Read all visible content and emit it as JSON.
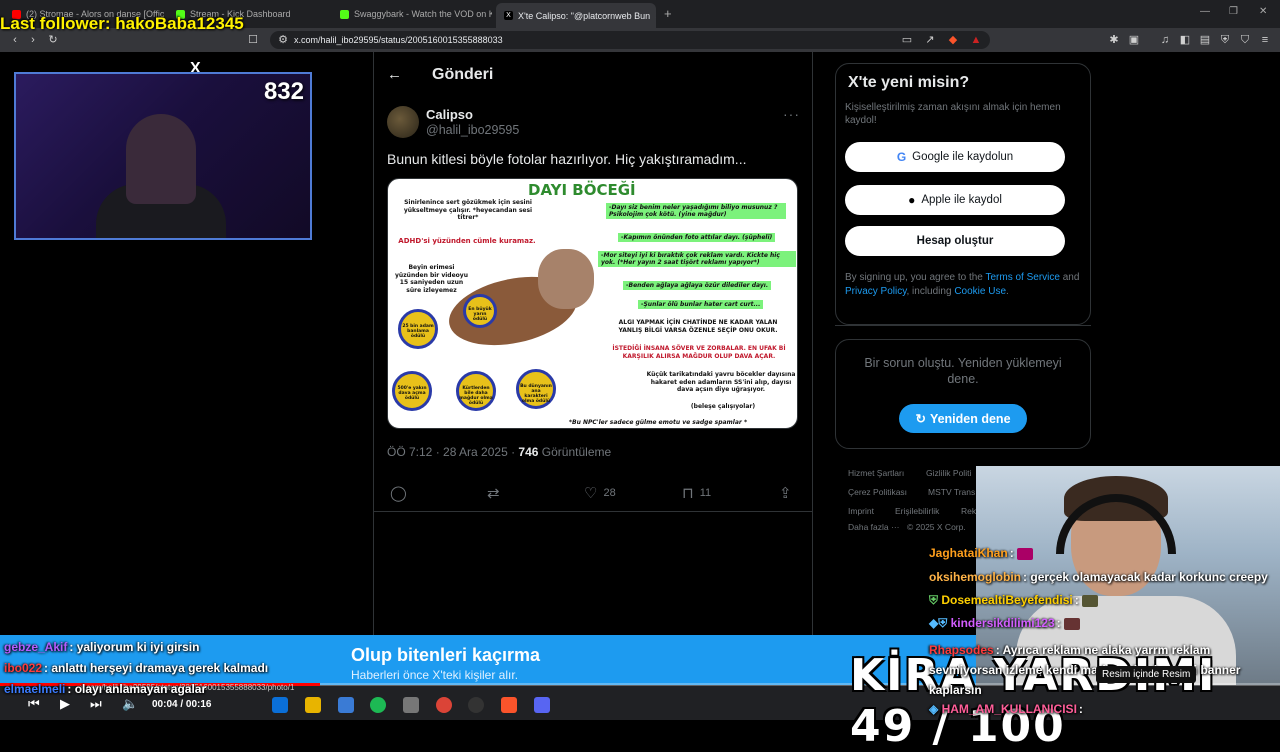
{
  "browser": {
    "tabs": [
      {
        "label": "(2) Stromae - Alors on danse [Official",
        "color": "#ff0000"
      },
      {
        "label": "Stream - Kick Dashboard",
        "color": "#53fc18"
      },
      {
        "label": "Swaggybark - Watch the VOD on Kic",
        "color": "#53fc18"
      },
      {
        "label": "X'te Calipso: \"@platcornweb Bun",
        "color": "#ffffff"
      }
    ],
    "url": "x.com/halil_ibo29595/status/2005160015355888033"
  },
  "stream": {
    "last_follower": "Last follower: hakoBaba12345",
    "viewer_count": "832",
    "x_logo": "X"
  },
  "post": {
    "back_icon": "←",
    "page_title": "Gönderi",
    "author_name": "Calipso",
    "author_handle": "@halil_ibo29595",
    "more_icon": "···",
    "text": "Bunun kitlesi böyle fotolar hazırlıyor. Hiç yakıştıramadım...",
    "meta_time": "ÖÖ 7:12 · 28 Ara 2025 · ",
    "views": "746",
    "views_label": " Görüntüleme",
    "likes": "28",
    "bookmarks": "11"
  },
  "meme": {
    "title": "DAYI BÖCEĞİ",
    "left_top": "Sinirlenince sert gözükmek için sesini yükseltmeye çalışır. *heyecandan sesi titrer*",
    "adhd": "ADHD'si yüzünden cümle kuramaz.",
    "brain": "Beyin erimesi yüzünden bir videoyu 15 saniyeden uzun süre izleyemez",
    "green1": "-Dayı siz benim neler yaşadığımı biliyo musunuz ? Psikolojim çok kötü. (yine mağdur)",
    "green2": "-Kapımın önünden foto attılar dayı. (şüpheli)",
    "green3": "-Mor siteyi iyi ki bıraktık çok reklam vardı. Kickte hiç yok. (*Her yayın 2 saat tişört reklamı yapıyor*)",
    "green4": "-Benden ağlaya ağlaya özür dilediler dayı.",
    "green5": "-Şunlar ölü bunlar hater cart curt...",
    "algi": "ALGI YAPMAK İÇİN CHATİNDE NE KADAR YALAN YANLIŞ BİLGİ VARSA ÖZENLE SEÇİP ONU OKUR.",
    "insana": "İSTEDİĞİ İNSANA SÖVER VE ZORBALAR. EN UFAK Bİ KARŞILIK ALIRSA MAĞDUR OLUP DAVA AÇAR.",
    "kucuk": "Küçük tarikatındaki yavru böcekler dayısına hakaret eden adamların SS'ini alıp, dayısı dava açsın diye uğraşıyor.",
    "belese": "(beleşe çalışıyolar)",
    "npc": "*Bu NPC'ler sadece gülme emotu ve sadge spamlar *",
    "medal1": "25 bin adam banlama ödülü",
    "medal2": "500'e yakın dava açma ödülü",
    "medal3": "Kürtlerden bile daha mağdur olma ödülü",
    "medal4": "Bu dünyanın ana karakteri olma ödülü",
    "medal5": "En büyük yarın ödülü"
  },
  "sidebar": {
    "signup_title": "X'te yeni misin?",
    "signup_desc": "Kişiselleştirilmiş zaman akışını almak için hemen kaydol!",
    "google_label": "Google ile kaydolun",
    "apple_label": "Apple ile kaydol",
    "create_label": "Hesap oluştur",
    "terms_prefix": "By signing up, you agree to the ",
    "terms_link": "Terms of Service",
    "terms_and": " and ",
    "privacy_link": "Privacy Policy",
    "terms_including": ", including ",
    "cookie_link": "Cookie Use",
    "terms_end": ".",
    "error_text": "Bir sorun oluştu. Yeniden yüklemeyi dene.",
    "retry_label": "Yeniden dene",
    "footer": [
      "Hizmet Şartları",
      "Gizlilik Politi",
      "Çerez Politikası",
      "MSTV Trans",
      "Imprint",
      "Erişilebilirlik",
      "Rek",
      "Daha fazla ···",
      "© 2025 X Corp."
    ]
  },
  "chat": [
    {
      "user": "JaghataiKhan",
      "color": "#ff9f1c",
      "text": ""
    },
    {
      "user": "oksihemoglobin",
      "color": "#ffb347",
      "text": "gerçek olamayacak kadar korkunc creepy"
    },
    {
      "user": "DosemealtiBeyefendisi",
      "color": "#ffd000",
      "text": ""
    },
    {
      "user": "kindersikdilimi123",
      "color": "#d35dff",
      "text": ""
    },
    {
      "user": "Rhapsodes",
      "color": "#ff3b3b",
      "text": "Ayrıca reklam ne alaka yarrm reklam sevmiyorsan izleme kendi markan olsa her yeri banner kaplarsın"
    },
    {
      "user": "HAM_AM_KULLANICISI",
      "color": "#ff5e99",
      "text": ""
    },
    {
      "user": "gebze_Akif",
      "color": "#b45dff",
      "text": "yaliyorum ki iyi girsin"
    },
    {
      "user": "ibo022",
      "color": "#ff3b3b",
      "text": "anlattı herşeyi dramaya gerek kalmadı"
    },
    {
      "user": "elmaelmeli",
      "color": "#3b7bff",
      "text": "olayı anlamayan agalar"
    }
  ],
  "banner": {
    "title": "Olup bitenleri kaçırma",
    "subtitle": "Haberleri önce X'teki kişiler alır.",
    "charity": "KİRA YARDIMI 49 / 100",
    "pip": "Resim içinde Resim"
  },
  "player": {
    "time": "00:04 / 00:16",
    "progress": 0.25,
    "url_overlay": "x.com/halil_ibo29595/status/2005160015355888033/photo/1"
  }
}
